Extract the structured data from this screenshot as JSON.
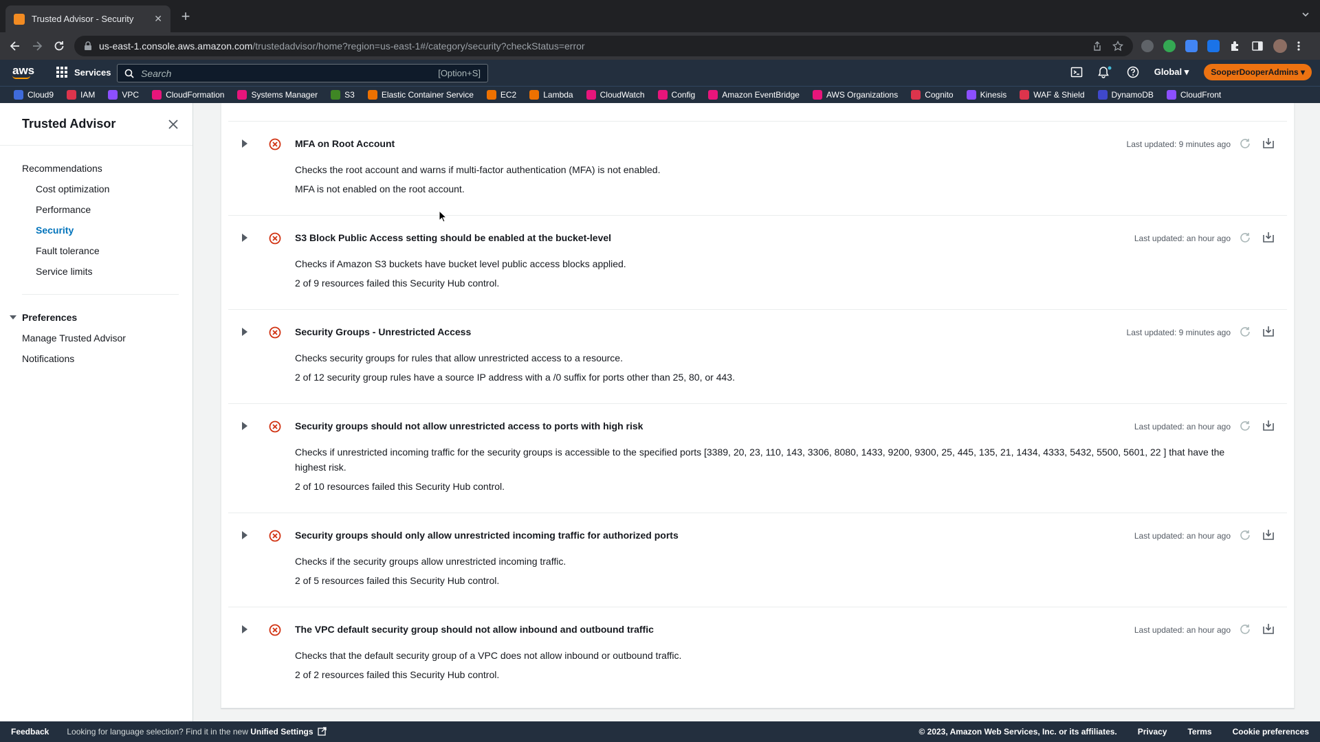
{
  "browser": {
    "tab_title": "Trusted Advisor - Security",
    "url_host": "us-east-1.console.aws.amazon.com",
    "url_path": "/trustedadvisor/home?region=us-east-1#/category/security?checkStatus=error"
  },
  "awsnav": {
    "logo": "aws",
    "services_label": "Services",
    "search_placeholder": "Search",
    "search_shortcut": "[Option+S]",
    "region": "Global ▾",
    "account": "SooperDooperAdmins ▾"
  },
  "favorites": [
    {
      "label": "Cloud9",
      "color": "#3f6bdb"
    },
    {
      "label": "IAM",
      "color": "#dd344c"
    },
    {
      "label": "VPC",
      "color": "#8c4fff"
    },
    {
      "label": "CloudFormation",
      "color": "#e7157b"
    },
    {
      "label": "Systems Manager",
      "color": "#e7157b"
    },
    {
      "label": "S3",
      "color": "#3f8624"
    },
    {
      "label": "Elastic Container Service",
      "color": "#ed7100"
    },
    {
      "label": "EC2",
      "color": "#ed7100"
    },
    {
      "label": "Lambda",
      "color": "#ed7100"
    },
    {
      "label": "CloudWatch",
      "color": "#e7157b"
    },
    {
      "label": "Config",
      "color": "#e7157b"
    },
    {
      "label": "Amazon EventBridge",
      "color": "#e7157b"
    },
    {
      "label": "AWS Organizations",
      "color": "#e7157b"
    },
    {
      "label": "Cognito",
      "color": "#dd344c"
    },
    {
      "label": "Kinesis",
      "color": "#8c4fff"
    },
    {
      "label": "WAF & Shield",
      "color": "#dd344c"
    },
    {
      "label": "DynamoDB",
      "color": "#3f48cc"
    },
    {
      "label": "CloudFront",
      "color": "#8c4fff"
    }
  ],
  "sidebar": {
    "title": "Trusted Advisor",
    "recommendations": "Recommendations",
    "items": [
      "Cost optimization",
      "Performance",
      "Security",
      "Fault tolerance",
      "Service limits"
    ],
    "active": "Security",
    "preferences": "Preferences",
    "pref_items": [
      "Manage Trusted Advisor",
      "Notifications"
    ]
  },
  "checks": [
    {
      "title": "MFA on Root Account",
      "description": "Checks the root account and warns if multi-factor authentication (MFA) is not enabled.",
      "result": "MFA is not enabled on the root account.",
      "updated": "Last updated: 9 minutes ago"
    },
    {
      "title": "S3 Block Public Access setting should be enabled at the bucket-level",
      "description": "Checks if Amazon S3 buckets have bucket level public access blocks applied.",
      "result": "2 of 9 resources failed this Security Hub control.",
      "updated": "Last updated: an hour ago"
    },
    {
      "title": "Security Groups - Unrestricted Access",
      "description": "Checks security groups for rules that allow unrestricted access to a resource.",
      "result": "2 of 12 security group rules have a source IP address with a /0 suffix for ports other than 25, 80, or 443.",
      "updated": "Last updated: 9 minutes ago"
    },
    {
      "title": "Security groups should not allow unrestricted access to ports with high risk",
      "description": "Checks if unrestricted incoming traffic for the security groups is accessible to the specified ports [3389, 20, 23, 110, 143, 3306, 8080, 1433, 9200, 9300, 25, 445, 135, 21, 1434, 4333, 5432, 5500, 5601, 22 ] that have the highest risk.",
      "result": "2 of 10 resources failed this Security Hub control.",
      "updated": "Last updated: an hour ago"
    },
    {
      "title": "Security groups should only allow unrestricted incoming traffic for authorized ports",
      "description": "Checks if the security groups allow unrestricted incoming traffic.",
      "result": "2 of 5 resources failed this Security Hub control.",
      "updated": "Last updated: an hour ago"
    },
    {
      "title": "The VPC default security group should not allow inbound and outbound traffic",
      "description": "Checks that the default security group of a VPC does not allow inbound or outbound traffic.",
      "result": "2 of 2 resources failed this Security Hub control.",
      "updated": "Last updated: an hour ago"
    }
  ],
  "footer": {
    "feedback": "Feedback",
    "lang_text": "Looking for language selection? Find it in the new ",
    "unified": "Unified Settings",
    "copyright": "© 2023, Amazon Web Services, Inc. or its affiliates.",
    "privacy": "Privacy",
    "terms": "Terms",
    "cookies": "Cookie preferences"
  },
  "colors": {
    "error_red": "#d13212",
    "link_blue": "#0073bb",
    "aws_orange": "#ec7211"
  }
}
